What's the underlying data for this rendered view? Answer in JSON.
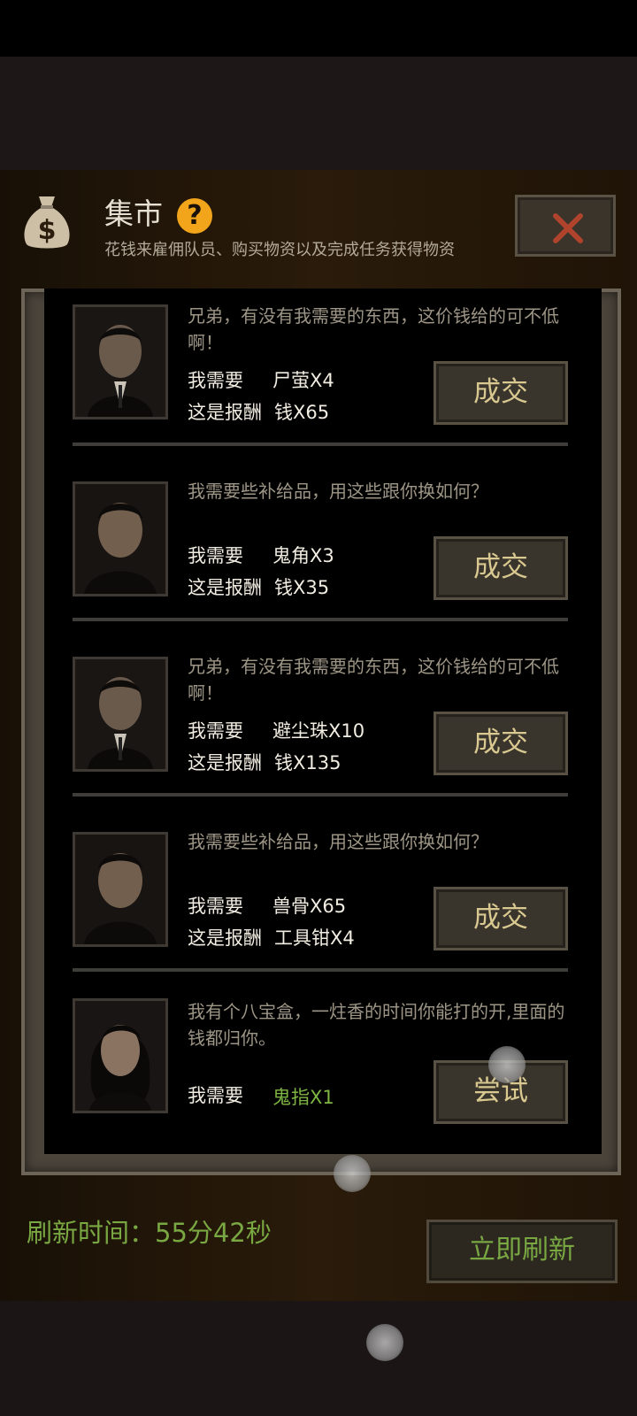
{
  "header": {
    "title": "集市",
    "help": "?",
    "subtitle": "花钱来雇佣队员、购买物资以及完成任务获得物资",
    "bag_icon": "money-bag-icon",
    "close_icon": "close-x-icon"
  },
  "offers": [
    {
      "dialogue": "兄弟，有没有我需要的东西，这价钱给的可不低啊！",
      "need_label": "我需要",
      "need_item": "尸萤X4",
      "reward_label": "这是报酬",
      "reward_item": "钱X65",
      "button": "成交"
    },
    {
      "dialogue": "我需要些补给品，用这些跟你换如何？",
      "need_label": "我需要",
      "need_item": "鬼角X3",
      "reward_label": "这是报酬",
      "reward_item": "钱X35",
      "button": "成交"
    },
    {
      "dialogue": "兄弟，有没有我需要的东西，这价钱给的可不低啊！",
      "need_label": "我需要",
      "need_item": "避尘珠X10",
      "reward_label": "这是报酬",
      "reward_item": "钱X135",
      "button": "成交"
    },
    {
      "dialogue": "我需要些补给品，用这些跟你换如何？",
      "need_label": "我需要",
      "need_item": "兽骨X65",
      "reward_label": "这是报酬",
      "reward_item": "工具钳X4",
      "button": "成交"
    },
    {
      "dialogue": "我有个八宝盒，一炷香的时间你能打的开,里面的钱都归你。",
      "need_label": "我需要",
      "need_item": "鬼指X1",
      "button": "尝试"
    }
  ],
  "footer": {
    "refresh_label": "刷新时间：",
    "refresh_time": "55分42秒",
    "refresh_button": "立即刷新"
  },
  "colors": {
    "accent_green": "#79a843",
    "button_text": "#d9c890",
    "help_orange": "#f2a51a",
    "close_red": "#b0432c"
  }
}
